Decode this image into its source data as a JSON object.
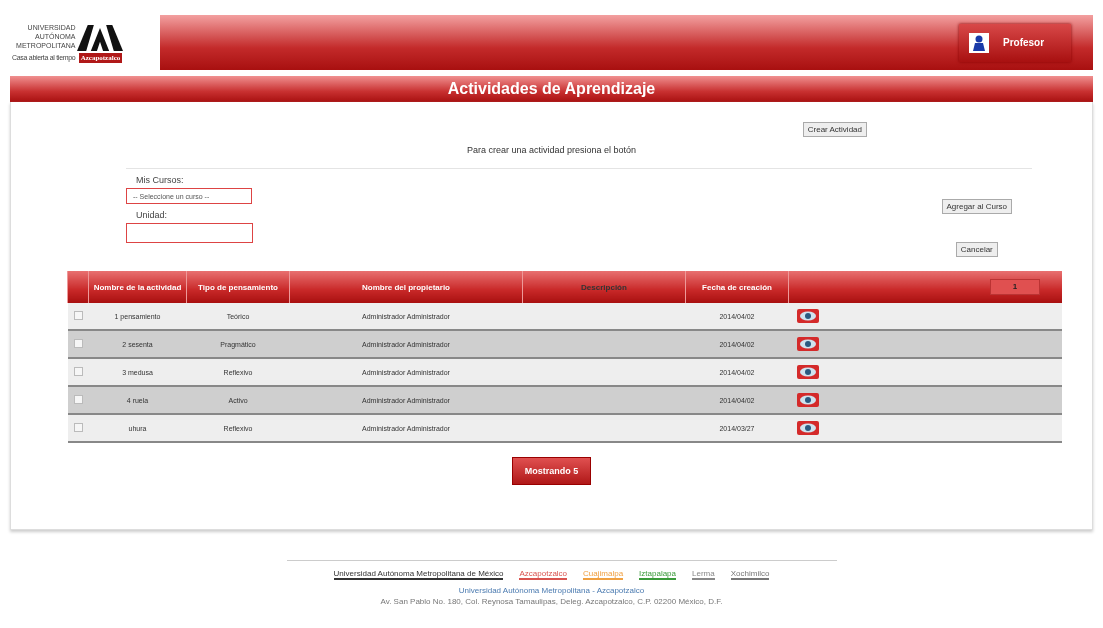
{
  "logo": {
    "lines": [
      "UNIVERSIDAD",
      "AUTÓNOMA",
      "METROPOLITANA"
    ],
    "motto": "Casa abierta al tiempo",
    "campus": "Azcapotzalco"
  },
  "user": {
    "label": "Profesor"
  },
  "title": "Actividades de Aprendizaje",
  "create": {
    "button": "Crear Actividad",
    "hint": "Para crear una actividad presiona el botón"
  },
  "form": {
    "course_label": "Mis Cursos:",
    "course_select": "-- Seleccione un curso --",
    "unit_label": "Unidad:",
    "add_button": "Agregar al Curso",
    "cancel_button": "Cancelar"
  },
  "table": {
    "columns": [
      "Nombre de la actividad",
      "Tipo de pensamiento",
      "Nombre del propietario",
      "Descripción",
      "Fecha de creación"
    ],
    "page": "1",
    "rows": [
      {
        "checked": false,
        "name": "1 pensamiento",
        "type": "Teórico",
        "owner": "Administrador Administrador",
        "date": "2014/04/02"
      },
      {
        "checked": false,
        "name": "2 sesenta",
        "type": "Pragmático",
        "owner": "Administrador Administrador",
        "date": "2014/04/02"
      },
      {
        "checked": false,
        "name": "3 medusa",
        "type": "Reflexivo",
        "owner": "Administrador Administrador",
        "date": "2014/04/02"
      },
      {
        "checked": false,
        "name": "4 ruela",
        "type": "Activo",
        "owner": "Administrador Administrador",
        "date": "2014/04/02"
      },
      {
        "checked": false,
        "name": "uhura",
        "type": "Reflexivo",
        "owner": "Administrador Administrador",
        "date": "2014/03/27"
      }
    ]
  },
  "show_button": "Mostrando 5",
  "footer": {
    "main_link": "Universidad Autónoma Metropolitana de México",
    "units": [
      {
        "label": "Azcapotzalco",
        "color": "#d9534f"
      },
      {
        "label": "Cuajimalpa",
        "color": "#f0a040"
      },
      {
        "label": "Iztapalapa",
        "color": "#3a9a3a"
      },
      {
        "label": "Lerma",
        "color": "#888888"
      },
      {
        "label": "Xochimilco",
        "color": "#777777"
      }
    ],
    "lines": [
      "Universidad Autónoma Metropolitana - Azcapotzalco",
      "Av. San Pablo No. 180, Col. Reynosa Tamaulipas, Deleg. Azcapotzalco, C.P. 02200 México, D.F."
    ]
  }
}
